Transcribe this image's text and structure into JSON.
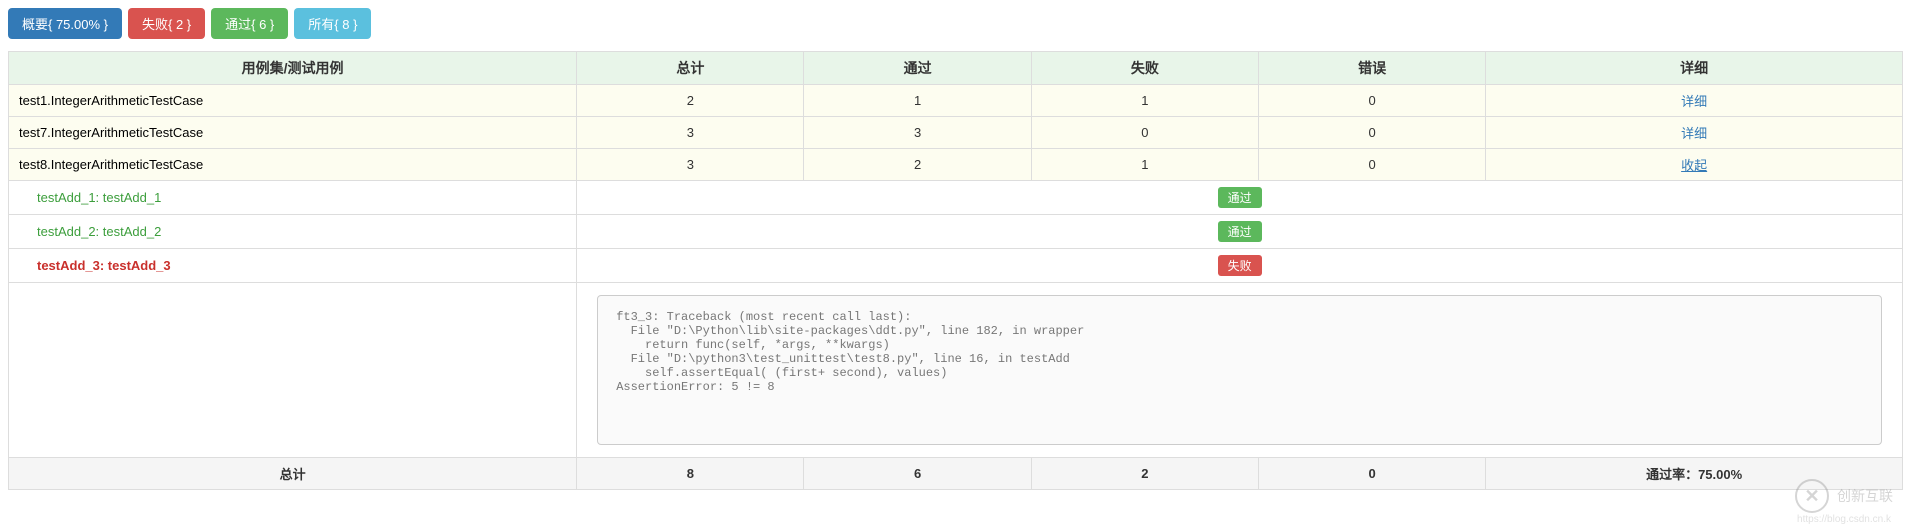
{
  "buttons": {
    "summary": "概要{ 75.00% }",
    "failed": "失败{ 2 }",
    "passed": "通过{ 6 }",
    "all": "所有{ 8 }"
  },
  "headers": {
    "name": "用例集/测试用例",
    "total": "总计",
    "pass": "通过",
    "fail": "失败",
    "error": "错误",
    "detail": "详细"
  },
  "suites": [
    {
      "name": "test1.IntegerArithmeticTestCase",
      "total": "2",
      "pass": "1",
      "fail": "1",
      "error": "0",
      "action": "详细",
      "action_underline": false
    },
    {
      "name": "test7.IntegerArithmeticTestCase",
      "total": "3",
      "pass": "3",
      "fail": "0",
      "error": "0",
      "action": "详细",
      "action_underline": false
    },
    {
      "name": "test8.IntegerArithmeticTestCase",
      "total": "3",
      "pass": "2",
      "fail": "1",
      "error": "0",
      "action": "收起",
      "action_underline": true
    }
  ],
  "tests": [
    {
      "name": "testAdd_1: testAdd_1",
      "status": "pass",
      "badge": "通过"
    },
    {
      "name": "testAdd_2: testAdd_2",
      "status": "pass",
      "badge": "通过"
    },
    {
      "name": "testAdd_3: testAdd_3",
      "status": "fail",
      "badge": "失败"
    }
  ],
  "traceback": "ft3_3: Traceback (most recent call last):\n  File \"D:\\Python\\lib\\site-packages\\ddt.py\", line 182, in wrapper\n    return func(self, *args, **kwargs)\n  File \"D:\\python3\\test_unittest\\test8.py\", line 16, in testAdd\n    self.assertEqual( (first+ second), values)\nAssertionError: 5 != 8",
  "footer": {
    "label": "总计",
    "total": "8",
    "pass": "6",
    "fail": "2",
    "error": "0",
    "rate": "通过率：75.00%"
  },
  "watermark": {
    "text": "创新互联",
    "sub": "https://blog.csdn.cn.k"
  }
}
